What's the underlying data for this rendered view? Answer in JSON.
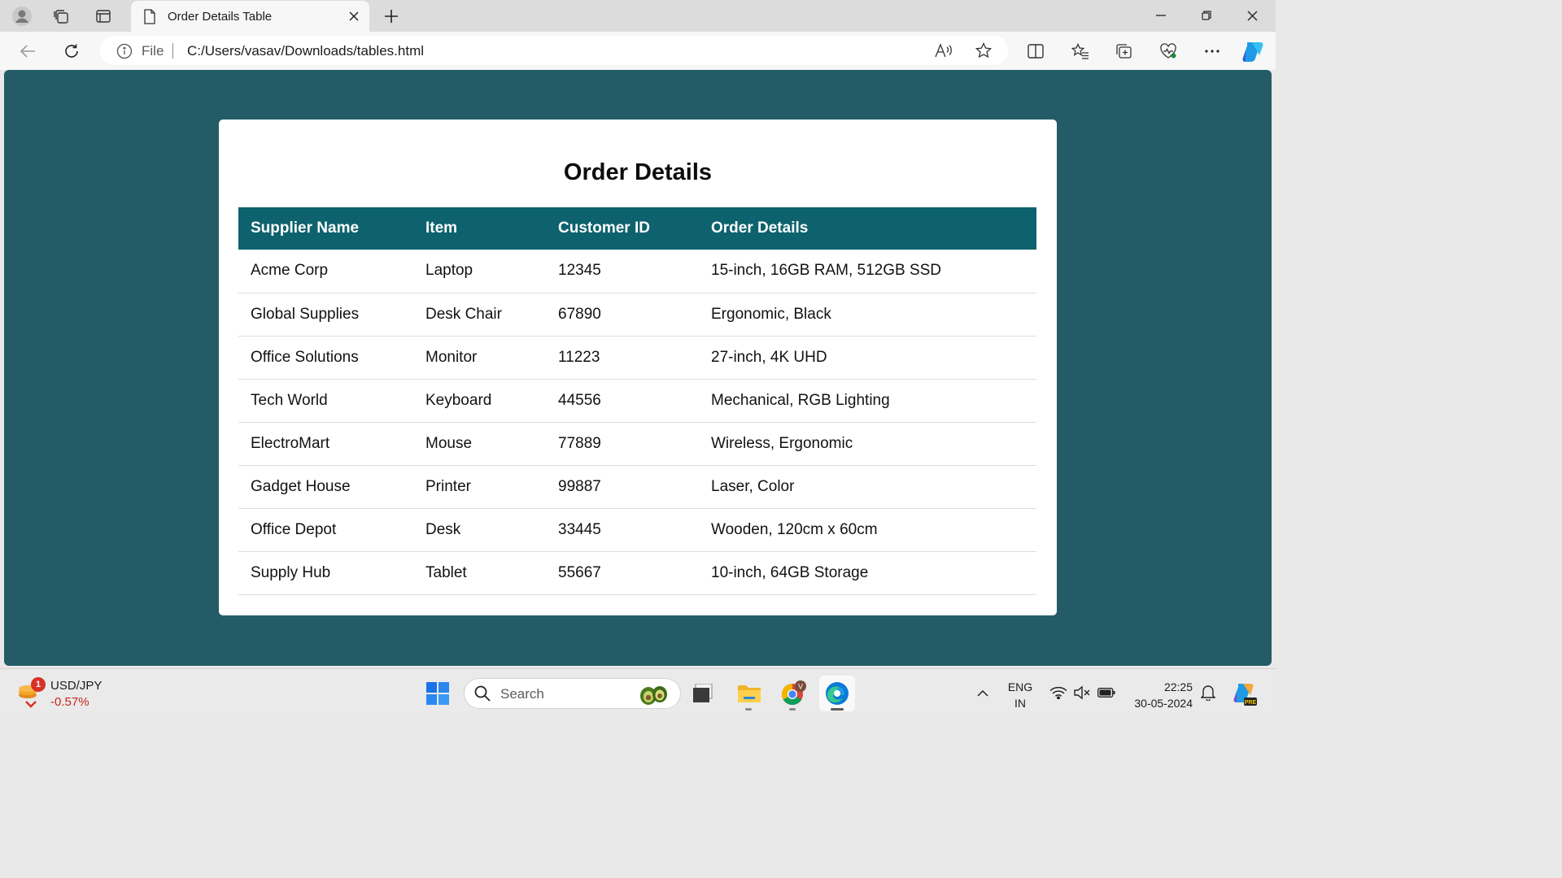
{
  "browser": {
    "tab_title": "Order Details Table",
    "url_scheme_label": "File",
    "url": "C:/Users/vasav/Downloads/tables.html"
  },
  "page": {
    "title": "Order Details",
    "table": {
      "headers": [
        "Supplier Name",
        "Item",
        "Customer ID",
        "Order Details"
      ],
      "rows": [
        [
          "Acme Corp",
          "Laptop",
          "12345",
          "15-inch, 16GB RAM, 512GB SSD"
        ],
        [
          "Global Supplies",
          "Desk Chair",
          "67890",
          "Ergonomic, Black"
        ],
        [
          "Office Solutions",
          "Monitor",
          "11223",
          "27-inch, 4K UHD"
        ],
        [
          "Tech World",
          "Keyboard",
          "44556",
          "Mechanical, RGB Lighting"
        ],
        [
          "ElectroMart",
          "Mouse",
          "77889",
          "Wireless, Ergonomic"
        ],
        [
          "Gadget House",
          "Printer",
          "99887",
          "Laser, Color"
        ],
        [
          "Office Depot",
          "Desk",
          "33445",
          "Wooden, 120cm x 60cm"
        ],
        [
          "Supply Hub",
          "Tablet",
          "55667",
          "10-inch, 64GB Storage"
        ]
      ]
    }
  },
  "taskbar": {
    "widget": {
      "label": "USD/JPY",
      "value": "-0.57%",
      "badge": "1"
    },
    "search_placeholder": "Search",
    "lang_line1": "ENG",
    "lang_line2": "IN",
    "time": "22:25",
    "date": "30-05-2024",
    "copilot_badge": "PRE"
  },
  "colors": {
    "page_background": "#235c66",
    "table_header": "#0d626d",
    "card": "#ffffff"
  }
}
